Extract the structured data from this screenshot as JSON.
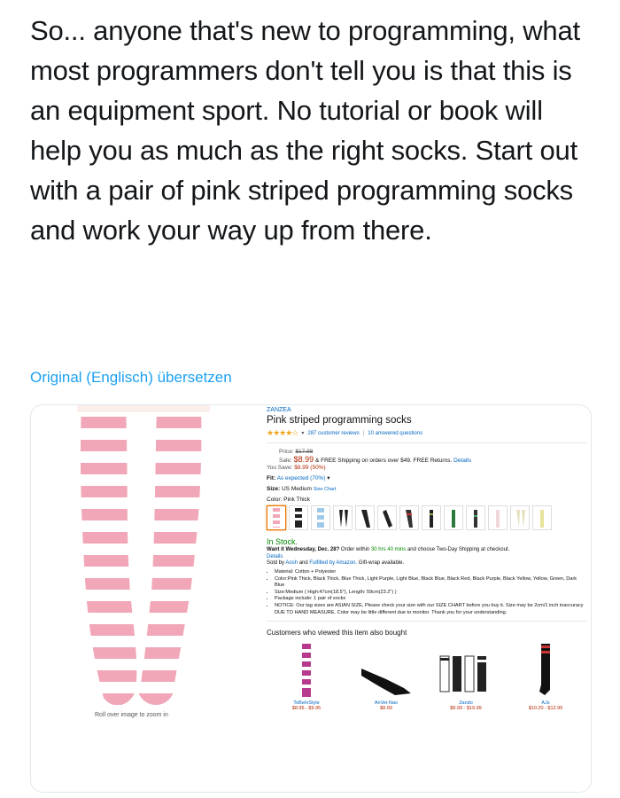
{
  "tweet": {
    "text": "So... anyone that's new to programming, what most programmers don't tell you is that this is an equipment sport. No tutorial or book will help you as much as the right socks. Start out with a pair of pink striped programming socks and work your way up from there.",
    "translate_link": "Original (Englisch) übersetzen"
  },
  "product": {
    "zoom_hint": "Roll over image to zoom in",
    "brand": "ZANZEA",
    "title": "Pink striped programming socks",
    "reviews": "287 customer reviews",
    "separator": "|",
    "questions": "10 answered questions",
    "price_label": "Price:",
    "list_price": "$17.98",
    "sale_label": "Sale:",
    "sale_price": "$8.99",
    "shipping": "& FREE Shipping on orders over $49.",
    "free_returns": "FREE Returns.",
    "details": "Details",
    "you_save_label": "You Save:",
    "you_save": "$8.99 (50%)",
    "fit_label": "Fit:",
    "fit_value": "As expected (70%)",
    "size_label": "Size:",
    "size_value": "US Medium",
    "size_chart": "Size Chart",
    "color_label": "Color:",
    "color_value": "Pink Thick",
    "stock": "In Stock.",
    "delivery_a": "Want it Wednesday, Dec. 28?",
    "delivery_b": "Order within",
    "delivery_hrs": "30 hrs 40 mins",
    "delivery_c": "and choose Two-Day Shipping at checkout.",
    "delivery_details": "Details",
    "sold_by_a": "Sold by",
    "sold_by_seller": "Aosh",
    "sold_by_b": "and",
    "sold_by_ful": "Fulfilled by Amazon.",
    "sold_by_c": "Gift-wrap available.",
    "bullets": [
      "Material: Cotton + Polyester",
      "Color:Pink Thick, Black Thick, Blue Thick, Light Purple, Light Blue, Black Blue, Black Red, Black Purple, Black Yellow, Yellow, Green, Dark Blue",
      "Size:Medium ( High:47cm(18.5\"), Length: 59cm(23.2\") )",
      "Package include: 1 pair of socks",
      "NOTICE: Our tag sizes are ASIAN SIZE, Please check your size with our SIZE CHART before you buy it. Size may be 2cm/1 inch inaccuracy DUE TO HAND MEASURE. Color may be little different due to monitor. Thank you for your understanding."
    ],
    "also_title": "Customers who viewed this item also bought",
    "also": [
      {
        "name": "ToBeInStyle",
        "price": "$8.95 - $9.95"
      },
      {
        "name": "AnVei-Nao",
        "price": "$8.99"
      },
      {
        "name": "Zando",
        "price": "$8.99 - $19.99"
      },
      {
        "name": "AJs",
        "price": "$10.20 - $12.95"
      }
    ]
  },
  "colors": {
    "link": "#1da1f2",
    "amazon_link": "#0066c0",
    "price_red": "#b12704",
    "stock_green": "#008a00",
    "star_orange": "#f0a41a",
    "stripe_pink": "#f1a7b7"
  }
}
